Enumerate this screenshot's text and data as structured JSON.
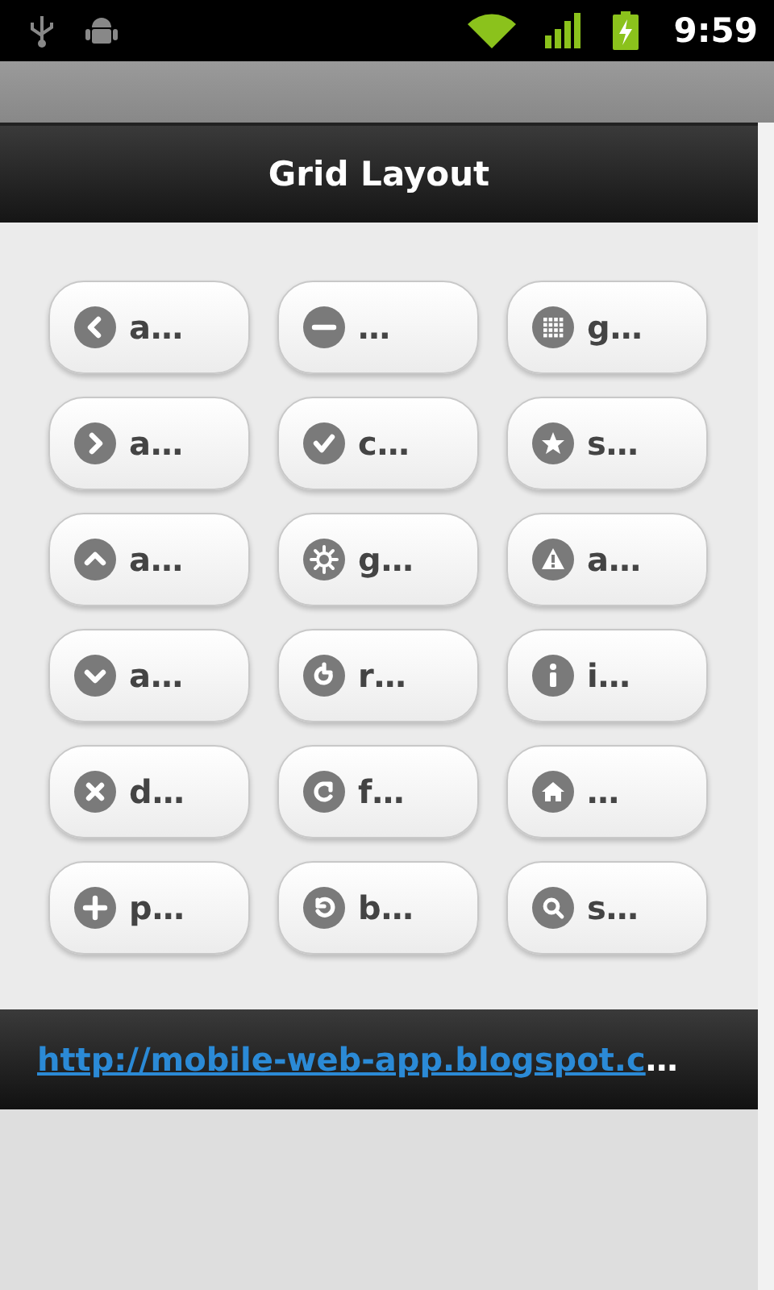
{
  "status_bar": {
    "time": "9:59"
  },
  "header": {
    "title": "Grid Layout"
  },
  "buttons": [
    {
      "kind": "arrow-left",
      "label": "a…"
    },
    {
      "kind": "minus",
      "label": "…"
    },
    {
      "kind": "grid",
      "label": "g…"
    },
    {
      "kind": "arrow-right",
      "label": "a…"
    },
    {
      "kind": "check",
      "label": "c…"
    },
    {
      "kind": "star",
      "label": "s…"
    },
    {
      "kind": "arrow-up",
      "label": "a…"
    },
    {
      "kind": "gear",
      "label": "g…"
    },
    {
      "kind": "alert",
      "label": "a…"
    },
    {
      "kind": "arrow-down",
      "label": "a…"
    },
    {
      "kind": "refresh",
      "label": "r…"
    },
    {
      "kind": "info",
      "label": "i…"
    },
    {
      "kind": "delete",
      "label": "d…"
    },
    {
      "kind": "forward",
      "label": "f…"
    },
    {
      "kind": "home",
      "label": "…"
    },
    {
      "kind": "plus",
      "label": "p…"
    },
    {
      "kind": "back",
      "label": "b…"
    },
    {
      "kind": "search",
      "label": "s…"
    }
  ],
  "footer": {
    "link": "http://mobile-web-app.blogspot.c",
    "ellipsis": "…"
  }
}
